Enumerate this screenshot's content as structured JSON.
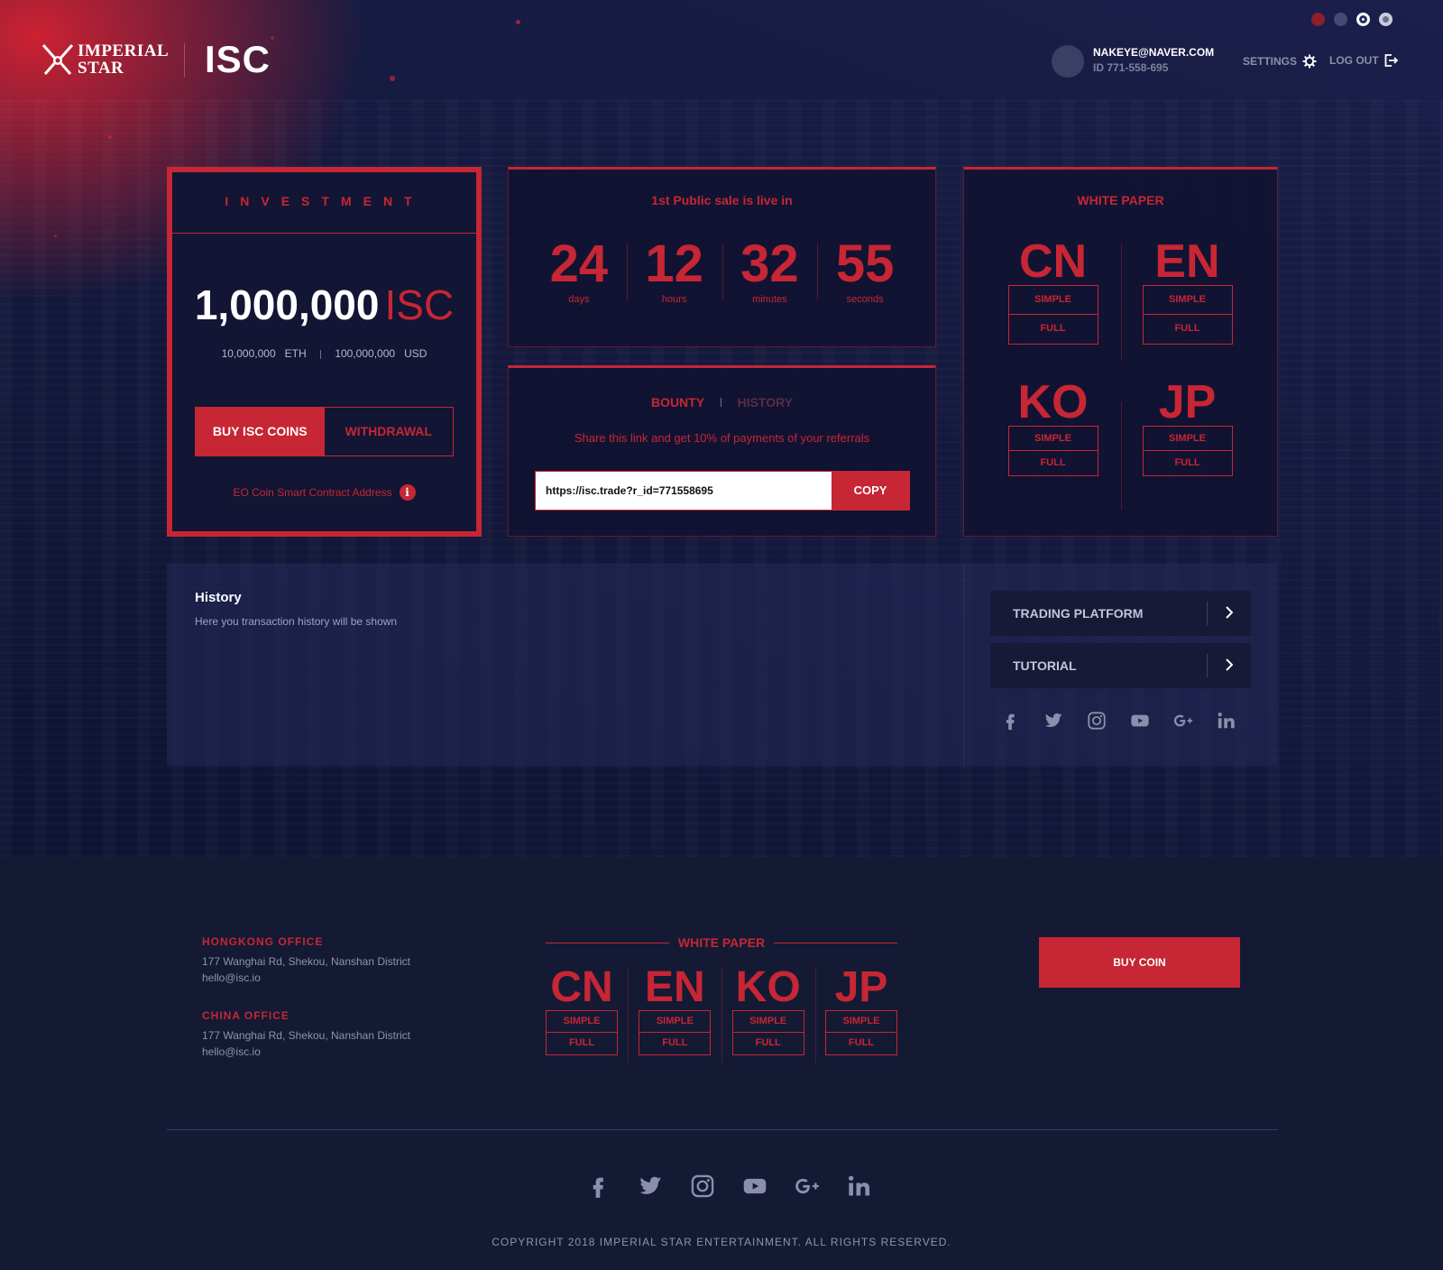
{
  "header": {
    "logo_line1": "IMPERIAL",
    "logo_line2": "STAR",
    "brand": "ISC",
    "user_email": "NAKEYE@NAVER.COM",
    "user_id": "ID 771-558-695",
    "settings_label": "SETTINGS",
    "logout_label": "LOG OUT",
    "flags": [
      "china-flag-icon",
      "uk-flag-icon",
      "korea-flag-icon",
      "japan-flag-icon"
    ]
  },
  "investment": {
    "title": "INVESTMENT",
    "amount": "1,000,000",
    "unit": "ISC",
    "eth_value": "10,000,000",
    "eth_unit": "ETH",
    "usd_value": "100,000,000",
    "usd_unit": "USD",
    "buy_label": "BUY ISC COINS",
    "withdraw_label": "WITHDRAWAL",
    "contract_label": "EO Coin Smart Contract Address"
  },
  "countdown": {
    "title": "1st Public sale is live in",
    "units": [
      {
        "value": "24",
        "label": "days"
      },
      {
        "value": "12",
        "label": "hours"
      },
      {
        "value": "32",
        "label": "minutes"
      },
      {
        "value": "55",
        "label": "seconds"
      }
    ]
  },
  "bounty": {
    "tab_active": "BOUNTY",
    "tab_inactive": "HISTORY",
    "message": "Share this link and get 10% of payments of your referrals",
    "referral_link": "https://isc.trade?r_id=771558695",
    "copy_label": "COPY"
  },
  "white_paper": {
    "title": "WHITE PAPER",
    "languages": [
      {
        "code": "CN",
        "simple": "SIMPLE",
        "full": "FULL"
      },
      {
        "code": "EN",
        "simple": "SIMPLE",
        "full": "FULL"
      },
      {
        "code": "KO",
        "simple": "SIMPLE",
        "full": "FULL"
      },
      {
        "code": "JP",
        "simple": "SIMPLE",
        "full": "FULL"
      }
    ]
  },
  "history": {
    "title": "History",
    "subtitle": "Here you transaction history will be shown"
  },
  "side": {
    "trading_label": "TRADING PLATFORM",
    "tutorial_label": "TUTORIAL",
    "socials": [
      "facebook-icon",
      "twitter-icon",
      "instagram-icon",
      "youtube-icon",
      "google-plus-icon",
      "linkedin-icon"
    ]
  },
  "footer": {
    "hk_title": "HONGKONG OFFICE",
    "hk_address": "177 Wanghai Rd, Shekou, Nanshan District",
    "hk_email": "hello@isc.io",
    "cn_title": "CHINA OFFICE",
    "cn_address": "177 Wanghai Rd, Shekou, Nanshan District",
    "cn_email": "hello@isc.io",
    "wp_title": "WHITE PAPER",
    "wp_languages": [
      {
        "code": "CN",
        "simple": "SIMPLE",
        "full": "FULL"
      },
      {
        "code": "EN",
        "simple": "SIMPLE",
        "full": "FULL"
      },
      {
        "code": "KO",
        "simple": "SIMPLE",
        "full": "FULL"
      },
      {
        "code": "JP",
        "simple": "SIMPLE",
        "full": "FULL"
      }
    ],
    "buy_coin_label": "BUY COIN",
    "copyright": "COPYRIGHT 2018 IMPERIAL STAR ENTERTAINMENT. ALL RIGHTS RESERVED."
  },
  "colors": {
    "accent": "#c72634",
    "background": "#141a33",
    "panel": "#161a37"
  }
}
